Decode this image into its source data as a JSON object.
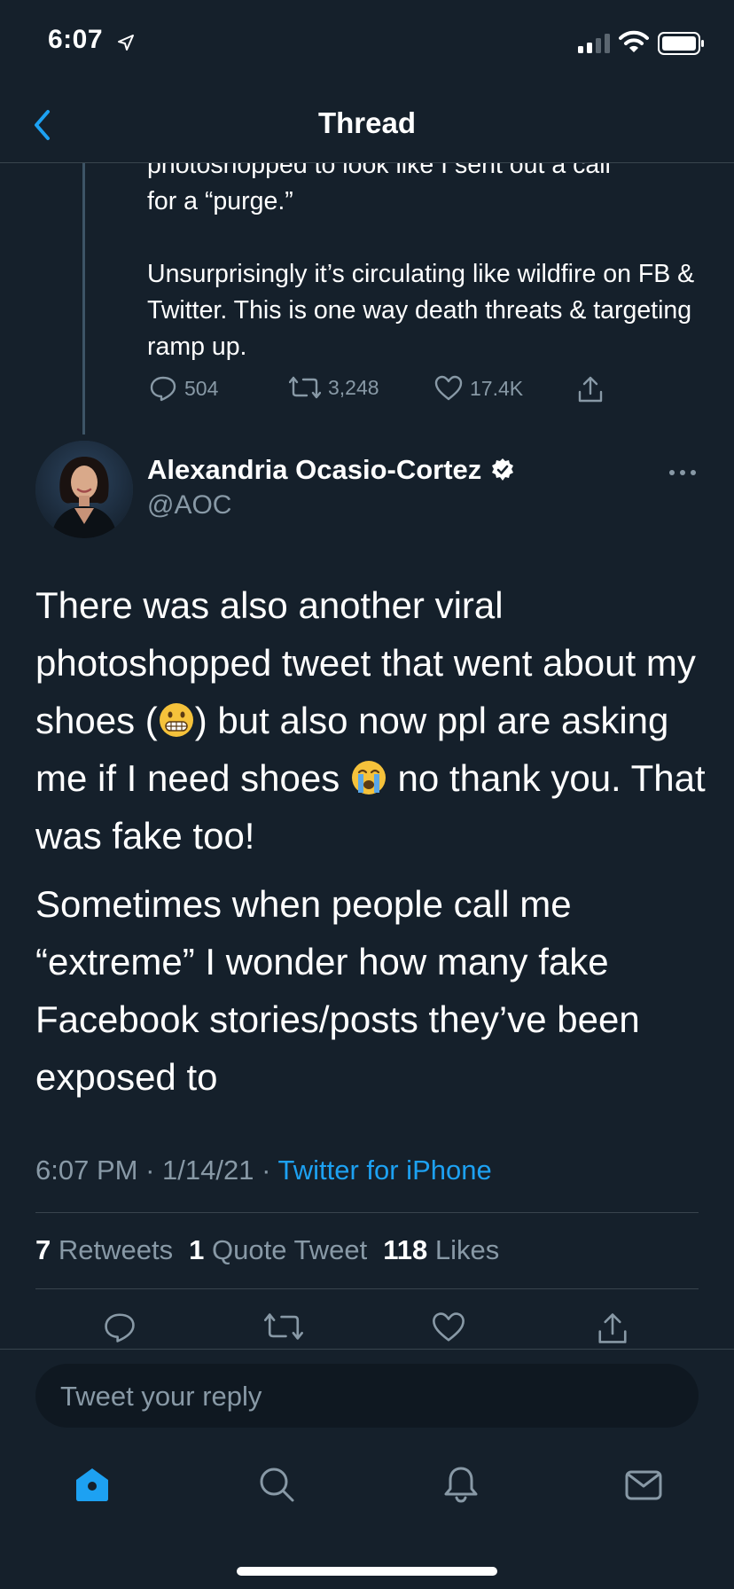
{
  "status_bar": {
    "time": "6:07"
  },
  "header": {
    "title": "Thread"
  },
  "previous_tweet": {
    "cut_line": "photoshopped to look like I sent out a call",
    "line2": "for a “purge.”",
    "paragraph2": "Unsurprisingly it’s circulating like wildfire on FB & Twitter. This is one way death threats & targeting ramp up.",
    "stats": {
      "replies": "504",
      "retweets": "3,248",
      "likes": "17.4K"
    }
  },
  "tweet": {
    "author_name": "Alexandria Ocasio-Cortez",
    "handle": "@AOC",
    "p1_part1": "There was also another viral photoshopped tweet that went about my shoes (",
    "p1_part2": ") but also now ppl are asking me if I need shoes ",
    "p1_part3": " no thank you. That was fake too!",
    "p2": "Sometimes when people call me “extreme” I wonder how many fake Facebook stories/posts they’ve been exposed to",
    "time": "6:07 PM",
    "date": "1/14/21",
    "separator": "·",
    "source": "Twitter for iPhone",
    "retweets_count": "7",
    "retweets_label": "Retweets",
    "quotes_count": "1",
    "quotes_label": "Quote Tweet",
    "likes_count": "118",
    "likes_label": "Likes"
  },
  "reply": {
    "placeholder": "Tweet your reply"
  },
  "icons": {
    "back": "chevron-left-icon",
    "verified": "verified-badge-icon",
    "more": "more-horizontal-icon",
    "reply": "comment-icon",
    "retweet": "retweet-icon",
    "like": "heart-icon",
    "share": "share-icon",
    "emoji1": "grimacing-face-emoji",
    "emoji2": "loudly-crying-face-emoji",
    "tabs": [
      "home-icon",
      "search-icon",
      "notifications-icon",
      "messages-icon"
    ]
  },
  "colors": {
    "background": "#15202b",
    "accent": "#1da1f2",
    "secondary_text": "#8899a6",
    "divider": "#38444d"
  }
}
